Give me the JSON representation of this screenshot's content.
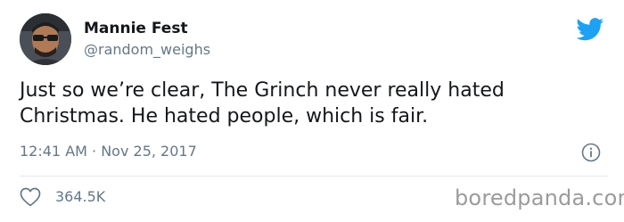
{
  "author": {
    "display_name": "Mannie Fest",
    "handle": "@random_weighs",
    "avatar_icon": "profile-photo"
  },
  "tweet": {
    "text": "Just so we’re clear, The Grinch never really hated Christmas. He hated people, which is fair.",
    "timestamp": "12:41 AM · Nov 25, 2017"
  },
  "engagement": {
    "likes": "364.5K"
  },
  "watermark": {
    "text": "boredpanda.com"
  },
  "colors": {
    "twitter_blue": "#1da1f2",
    "secondary_text": "#657786",
    "primary_text": "#14171a",
    "divider": "#e1e8ed"
  },
  "icons": {
    "brand": "twitter-bird-icon",
    "info": "info-icon",
    "like": "heart-icon"
  }
}
